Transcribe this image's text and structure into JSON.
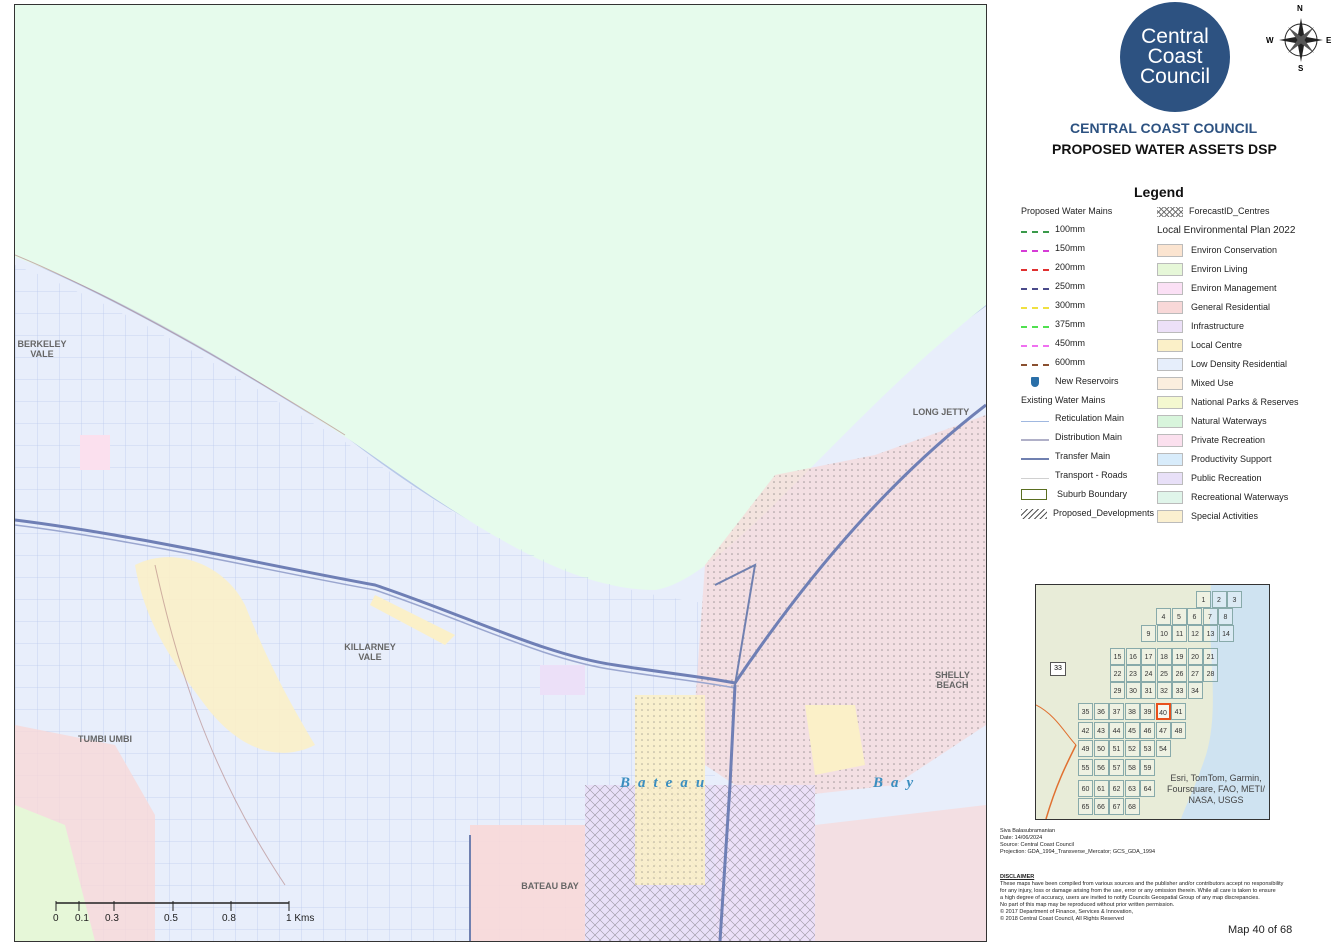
{
  "header": {
    "logo_lines": [
      "Central",
      "Coast",
      "Council"
    ],
    "org_title": "CENTRAL COAST COUNCIL",
    "map_title": "PROPOSED WATER ASSETS DSP",
    "compass": {
      "n": "N",
      "e": "E",
      "s": "S",
      "w": "W"
    }
  },
  "legend": {
    "title": "Legend",
    "proposed_group": "Proposed Water Mains",
    "proposed": [
      {
        "label": "100mm",
        "color": "#3a9a4a"
      },
      {
        "label": "150mm",
        "color": "#d63cd6"
      },
      {
        "label": "200mm",
        "color": "#e03030"
      },
      {
        "label": "250mm",
        "color": "#4a4a8a"
      },
      {
        "label": "300mm",
        "color": "#f0e040"
      },
      {
        "label": "375mm",
        "color": "#50e050"
      },
      {
        "label": "450mm",
        "color": "#f070f0"
      },
      {
        "label": "600mm",
        "color": "#8a5030"
      }
    ],
    "reservoirs": "New Reservoirs",
    "existing_group": "Existing Water Mains",
    "existing": [
      {
        "label": "Reticulation Main",
        "color": "#a0b8e0"
      },
      {
        "label": "Distribution Main",
        "color": "#b0b0c8"
      },
      {
        "label": "Transfer Main",
        "color": "#7080b0"
      },
      {
        "label": "Transport - Roads",
        "color": "#d0d0d0"
      }
    ],
    "suburb_boundary": "Suburb Boundary",
    "proposed_developments": "Proposed_Developments",
    "forecast_centres": "ForecastID_Centres",
    "lep_title": "Local Environmental Plan 2022",
    "lep": [
      {
        "label": "Environ Conservation",
        "color": "#fbe4d0"
      },
      {
        "label": "Environ Living",
        "color": "#e6f7d8"
      },
      {
        "label": "Environ Management",
        "color": "#fbe0f5"
      },
      {
        "label": "General Residential",
        "color": "#f8d8d8"
      },
      {
        "label": "Infrastructure",
        "color": "#ece0f8"
      },
      {
        "label": "Local Centre",
        "color": "#fbf0c8"
      },
      {
        "label": "Low Density Residential",
        "color": "#e6eefb"
      },
      {
        "label": "Mixed Use",
        "color": "#fbeede"
      },
      {
        "label": "National Parks & Reserves",
        "color": "#f4f8d0"
      },
      {
        "label": "Natural Waterways",
        "color": "#d8f5dc"
      },
      {
        "label": "Private Recreation",
        "color": "#fbe0ee"
      },
      {
        "label": "Productivity Support",
        "color": "#d8ecfb"
      },
      {
        "label": "Public Recreation",
        "color": "#e8e0f8"
      },
      {
        "label": "Recreational Waterways",
        "color": "#e0f5ea"
      },
      {
        "label": "Special Activities",
        "color": "#fbf0d0"
      }
    ]
  },
  "map": {
    "places": {
      "berkeley_vale": "BERKELEY VALE",
      "long_jetty": "LONG JETTY",
      "killarney_vale": "KILLARNEY VALE",
      "shelly_beach": "SHELLY BEACH",
      "tumbi_umbi": "TUMBI UMBI",
      "bateau_bay": "BATEAU BAY"
    },
    "water_labels": {
      "bateau": "Bateau",
      "bay": "Bay"
    },
    "scale": {
      "ticks": [
        "0",
        "0.1",
        "0.3",
        "0.5",
        "0.8",
        "1 Kms"
      ]
    }
  },
  "inset": {
    "attribution": "Esri, TomTom, Garmin, Foursquare, FAO, METI/ NASA, USGS",
    "highway": "33",
    "current": "40"
  },
  "meta": {
    "lines": [
      "Siva Balasubramanian",
      "Date: 14/06/2024",
      "Source: Central Coast Council",
      "Projection: GDA_1994_Transverse_Mercator; GCS_GDA_1994"
    ],
    "disclaimer_title": "DISCLAIMER",
    "disclaimer": [
      "These maps have been compiled from various sources and the publisher and/or contributors accept no responsibility",
      "for any injury, loss or damage arising from the use, error or any omission therein. While all care is taken to ensure",
      "a high degree of accuracy, users are invited to notify Councils Geospatial Group of any map discrepancies.",
      "No part of this map may be reproduced without prior written permission.",
      "© 2017 Department of Finance, Services & Innovation,",
      "© 2018 Central Coast Council, All Rights Reserved"
    ],
    "page": "Map 40 of 68"
  }
}
